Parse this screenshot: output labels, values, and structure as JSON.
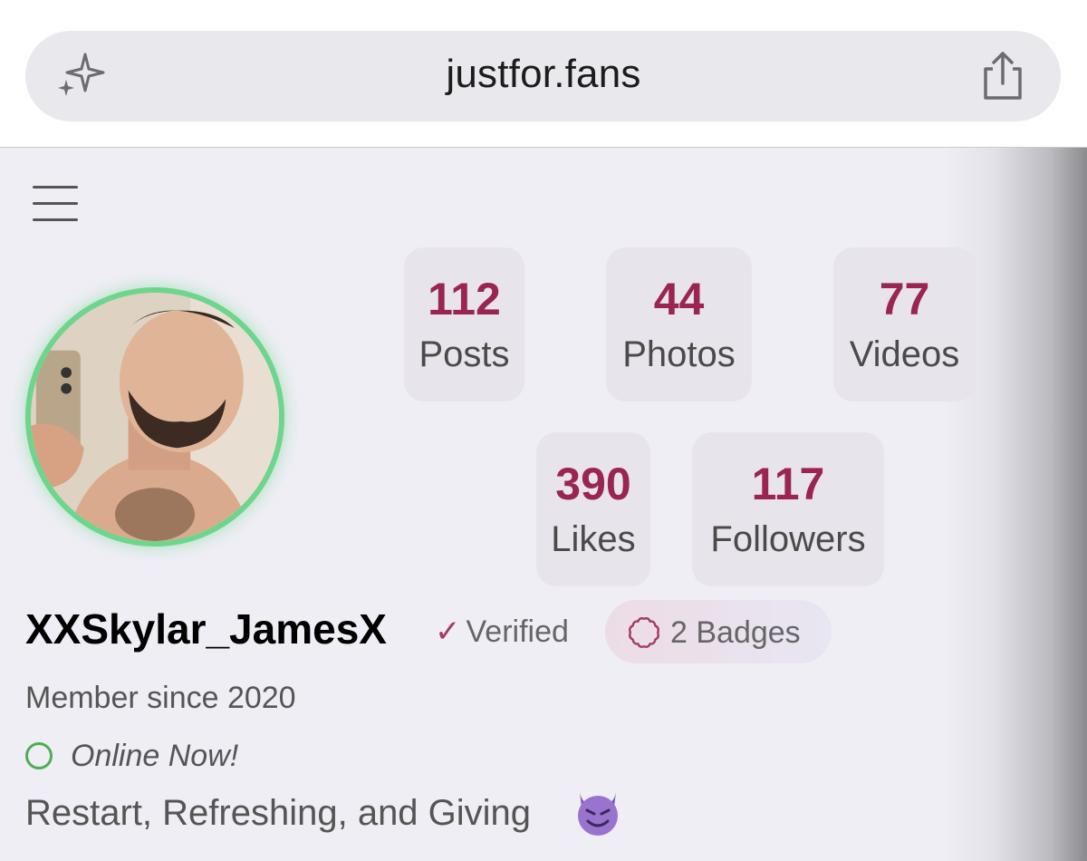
{
  "browser": {
    "url": "justfor.fans",
    "icons": {
      "left": "sparkle-icon",
      "right": "share-icon"
    }
  },
  "profile": {
    "menu_icon": "hamburger-icon",
    "stats": [
      {
        "value": "112",
        "label": "Posts"
      },
      {
        "value": "44",
        "label": "Photos"
      },
      {
        "value": "77",
        "label": "Videos"
      },
      {
        "value": "390",
        "label": "Likes"
      },
      {
        "value": "117",
        "label": "Followers"
      }
    ],
    "username": "XXSkylar_JamesX",
    "verified_check": "✓",
    "verified_label": "Verified",
    "badges_label": "2 Badges",
    "member_since": "Member since 2020",
    "status": "Online Now!",
    "bio": "Restart, Refreshing, and Giving",
    "bio_emoji": "smiling-devil-emoji"
  },
  "colors": {
    "stat_value": "#9a2454",
    "avatar_ring": "#6dd58c",
    "online": "#4caf50",
    "verified_check": "#a33a62",
    "page_bg": "#efeef5"
  }
}
